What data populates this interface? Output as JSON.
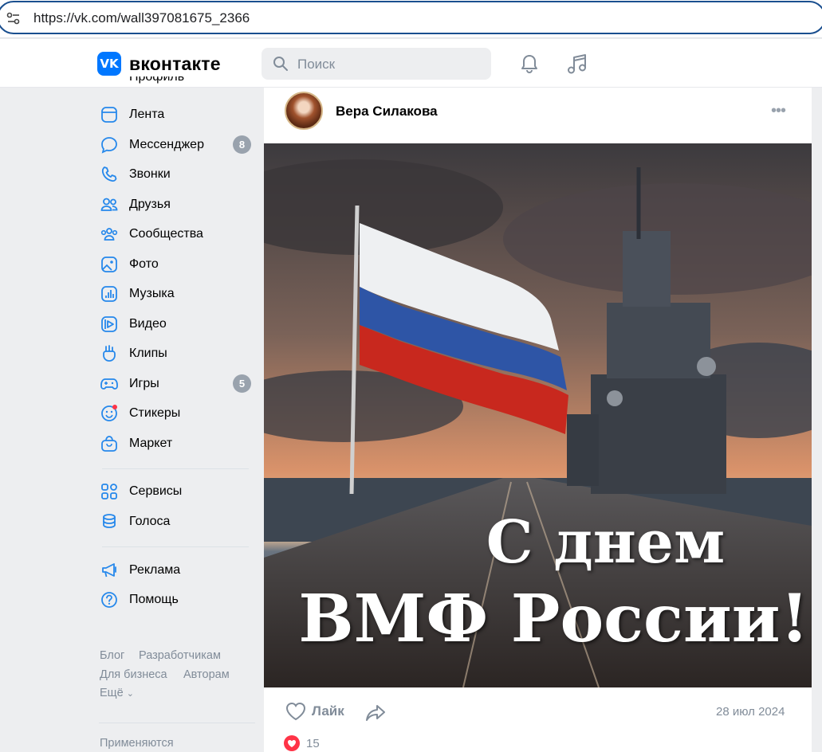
{
  "browser": {
    "url": "https://vk.com/wall397081675_2366"
  },
  "header": {
    "logo_icon": "vk-logo-icon",
    "logo_text": "вконтакте",
    "search_placeholder": "Поиск",
    "icons": [
      "bell-icon",
      "music-note-icon"
    ],
    "accent": "#0077ff"
  },
  "sidebar": {
    "partial_item": "Профиль",
    "items": [
      {
        "label": "Лента",
        "icon": "news-feed-icon"
      },
      {
        "label": "Мессенджер",
        "icon": "chat-bubble-icon",
        "badge": "8"
      },
      {
        "label": "Звонки",
        "icon": "phone-icon"
      },
      {
        "label": "Друзья",
        "icon": "friends-icon"
      },
      {
        "label": "Сообщества",
        "icon": "communities-icon"
      },
      {
        "label": "Фото",
        "icon": "photo-icon"
      },
      {
        "label": "Музыка",
        "icon": "music-icon"
      },
      {
        "label": "Видео",
        "icon": "video-icon"
      },
      {
        "label": "Клипы",
        "icon": "clips-icon"
      },
      {
        "label": "Игры",
        "icon": "gamepad-icon",
        "badge": "5"
      },
      {
        "label": "Стикеры",
        "icon": "sticker-icon"
      },
      {
        "label": "Маркет",
        "icon": "market-bag-icon"
      }
    ],
    "items2": [
      {
        "label": "Сервисы",
        "icon": "services-grid-icon"
      },
      {
        "label": "Голоса",
        "icon": "votes-coins-icon"
      }
    ],
    "items3": [
      {
        "label": "Реклама",
        "icon": "megaphone-icon"
      },
      {
        "label": "Помощь",
        "icon": "help-icon"
      }
    ],
    "footer": {
      "blog": "Блог",
      "developers": "Разработчикам",
      "business": "Для бизнеса",
      "authors": "Авторам",
      "more": "Ещё",
      "cookies": "Применяются"
    }
  },
  "post": {
    "author": "Вера Силакова",
    "image_caption_line1": "С днем",
    "image_caption_line2": "ВМФ России!",
    "like_label": "Лайк",
    "date": "28 июл 2024",
    "reactions_count": "15",
    "like_color": "#ff3347"
  }
}
